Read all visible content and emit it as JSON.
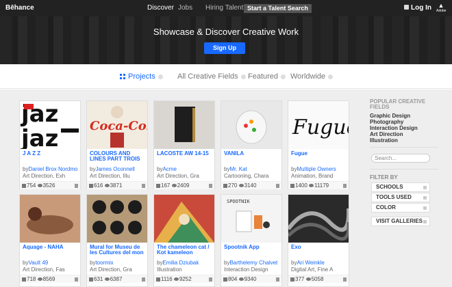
{
  "topbar": {
    "brand": "Bēhance",
    "discover": "Discover",
    "jobs": "Jobs",
    "hiring": "Hiring Talent?",
    "talent_search": "Start a Talent Search",
    "login": "Log In",
    "adobe": "Adobe"
  },
  "hero": {
    "headline": "Showcase & Discover Creative Work",
    "signup": "Sign Up"
  },
  "filters": {
    "projects": "Projects",
    "fields": "All Creative Fields",
    "featured": "Featured",
    "region": "Worldwide"
  },
  "cards": [
    {
      "title": "J A Z Z",
      "by": "by",
      "author": "Daniel Brox Nordmo",
      "fields": "Art Direction, Exh",
      "likes": "754",
      "views": "3526"
    },
    {
      "title": "COLOURS AND LINES PART TROIS",
      "by": "by",
      "author": "James Oconnell",
      "fields": "Art Direction, Illu",
      "likes": "616",
      "views": "3871"
    },
    {
      "title": "LACOSTE AW 14-15",
      "by": "by",
      "author": "Acme",
      "fields": "Art Direction, Gra",
      "likes": "167",
      "views": "2409"
    },
    {
      "title": "VANILA",
      "by": "by",
      "author": "Mr. Kat",
      "fields": "Cartooning, Chara",
      "likes": "270",
      "views": "3140"
    },
    {
      "title": "Fugue",
      "by": "by",
      "author": "Multiple Owners",
      "fields": "Animation, Brand",
      "likes": "1400",
      "views": "11179"
    },
    {
      "title": "Aquage - NAHA",
      "by": "by",
      "author": "Vault 49",
      "fields": "Art Direction, Fas",
      "likes": "718",
      "views": "8569"
    },
    {
      "title": "Mural for Museu de les Cultures del mon",
      "by": "by",
      "author": "toormix",
      "fields": "Art Direction, Gra",
      "likes": "631",
      "views": "6387"
    },
    {
      "title": "The chameleon cat / Kot kameleon",
      "by": "by",
      "author": "Emilia Dziubak",
      "fields": "Illustration",
      "likes": "1116",
      "views": "9252"
    },
    {
      "title": "Spootnik App",
      "by": "by",
      "author": "Barthelemy Chalvet",
      "fields": "Interaction Design",
      "likes": "804",
      "views": "9340"
    },
    {
      "title": "Exo",
      "by": "by",
      "author": "Ari Weinkle",
      "fields": "Digital Art, Fine A",
      "likes": "377",
      "views": "5058"
    }
  ],
  "sidebar": {
    "popular_heading": "POPULAR CREATIVE FIELDS",
    "popular": [
      "Graphic Design",
      "Photography",
      "Interaction Design",
      "Art Direction",
      "Illustration"
    ],
    "search_placeholder": "Search...",
    "filter_by": "FILTER BY",
    "buttons": [
      "SCHOOLS",
      "TOOLS USED",
      "COLOR",
      "VISIT GALLERIES"
    ]
  }
}
